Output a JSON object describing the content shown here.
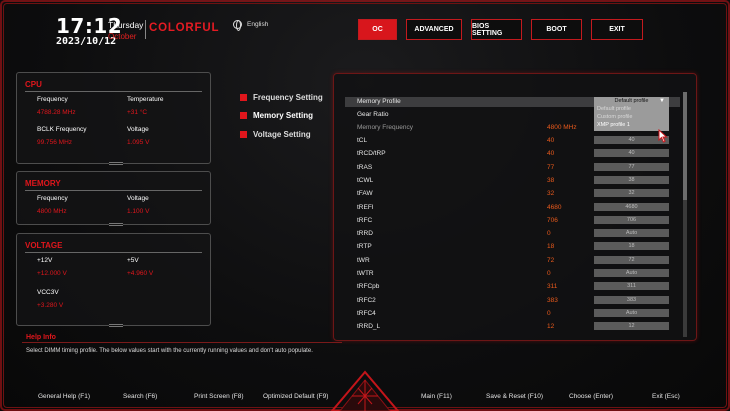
{
  "header": {
    "time": "17:12",
    "date": "2023/10/12",
    "weekday": "Thursday",
    "month": "October",
    "brand": "COLORFUL",
    "language": "English"
  },
  "nav": [
    "OC",
    "ADVANCED",
    "BIOS SETTING",
    "BOOT",
    "EXIT"
  ],
  "cpu_panel": {
    "title": "CPU",
    "frequency_label": "Frequency",
    "frequency_value": "4788.28 MHz",
    "temperature_label": "Temperature",
    "temperature_value": "+31 °C",
    "bclk_label": "BCLK Frequency",
    "bclk_value": "99.756 MHz",
    "voltage_label": "Voltage",
    "voltage_value": "1.095 V"
  },
  "memory_panel": {
    "title": "MEMORY",
    "frequency_label": "Frequency",
    "frequency_value": "4800 MHz",
    "voltage_label": "Voltage",
    "voltage_value": "1.100 V"
  },
  "voltage_panel": {
    "title": "VOLTAGE",
    "v12_label": "+12V",
    "v12_value": "+12.000 V",
    "v5_label": "+5V",
    "v5_value": "+4.960 V",
    "vcc3_label": "VCC3V",
    "vcc3_value": "+3.280 V"
  },
  "side_menu": [
    "Frequency Setting",
    "Memory Setting",
    "Voltage Setting"
  ],
  "settings": {
    "memory_profile": {
      "label": "Memory Profile",
      "selected": "Default profile",
      "options": [
        "Default profile",
        "Custom profile",
        "XMP profile 1"
      ]
    },
    "gear_ratio": "Gear Ratio",
    "memory_frequency": {
      "label": "Memory Frequency",
      "value": "4800 MHz"
    },
    "rows": [
      {
        "label": "tCL",
        "value": "40",
        "box": "40"
      },
      {
        "label": "tRCD/tRP",
        "value": "40",
        "box": "40"
      },
      {
        "label": "tRAS",
        "value": "77",
        "box": "77"
      },
      {
        "label": "tCWL",
        "value": "38",
        "box": "38"
      },
      {
        "label": "tFAW",
        "value": "32",
        "box": "32"
      },
      {
        "label": "tREFI",
        "value": "4680",
        "box": "4680"
      },
      {
        "label": "tRFC",
        "value": "706",
        "box": "706"
      },
      {
        "label": "tRRD",
        "value": "0",
        "box": "Auto"
      },
      {
        "label": "tRTP",
        "value": "18",
        "box": "18"
      },
      {
        "label": "tWR",
        "value": "72",
        "box": "72"
      },
      {
        "label": "tWTR",
        "value": "0",
        "box": "Auto"
      },
      {
        "label": "tRFCpb",
        "value": "311",
        "box": "311"
      },
      {
        "label": "tRFC2",
        "value": "383",
        "box": "383"
      },
      {
        "label": "tRFC4",
        "value": "0",
        "box": "Auto"
      },
      {
        "label": "tRRD_L",
        "value": "12",
        "box": "12"
      }
    ]
  },
  "help": {
    "title": "Help Info",
    "text": "Select DIMM timing profile. The below values start with the currently running values and don't auto populate."
  },
  "footer": [
    "General Help (F1)",
    "Search (F6)",
    "Print Screen (F8)",
    "Optimized Default (F9)",
    "Main (F11)",
    "Save & Reset (F10)",
    "Choose (Enter)",
    "Exit (Esc)"
  ],
  "colors": {
    "accent": "#e0161c",
    "value": "#ea5a1c",
    "panel_border": "#4d4d4d"
  },
  "icons": [
    "globe-icon",
    "dropdown-caret-icon",
    "mouse-cursor-icon",
    "colorful-emblem-icon"
  ]
}
